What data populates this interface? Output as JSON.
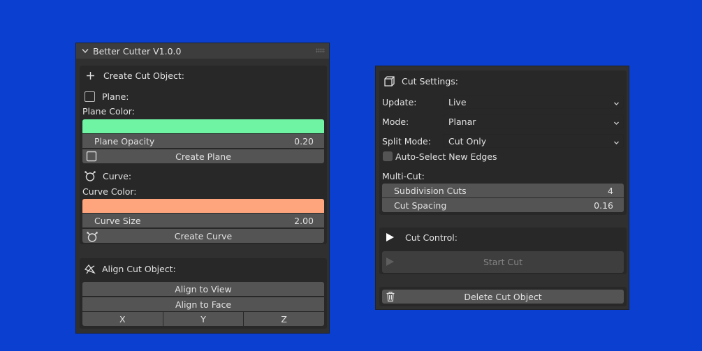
{
  "left_panel": {
    "title": "Better Cutter V1.0.0",
    "create_section": {
      "heading": "Create Cut Object:",
      "plane_label": "Plane:",
      "plane_color_label": "Plane Color:",
      "plane_color": "#6ff4a4",
      "plane_opacity_label": "Plane Opacity",
      "plane_opacity_value": "0.20",
      "create_plane_label": "Create Plane",
      "curve_label": "Curve:",
      "curve_color_label": "Curve Color:",
      "curve_color": "#ffa57d",
      "curve_size_label": "Curve Size",
      "curve_size_value": "2.00",
      "create_curve_label": "Create Curve"
    },
    "align_section": {
      "heading": "Align Cut Object:",
      "align_view_label": "Align to View",
      "align_face_label": "Align to Face",
      "axes": [
        "X",
        "Y",
        "Z"
      ]
    }
  },
  "right_panel": {
    "settings": {
      "heading": "Cut Settings:",
      "update_label": "Update:",
      "update_value": "Live",
      "mode_label": "Mode:",
      "mode_value": "Planar",
      "split_mode_label": "Split Mode:",
      "split_mode_value": "Cut Only",
      "auto_select_label": "Auto-Select New Edges",
      "multi_cut_label": "Multi-Cut:",
      "subdivision_label": "Subdivision Cuts",
      "subdivision_value": "4",
      "spacing_label": "Cut Spacing",
      "spacing_value": "0.16"
    },
    "control": {
      "heading": "Cut Control:",
      "start_label": "Start Cut"
    },
    "delete_label": "Delete Cut Object"
  },
  "colors": {
    "background": "#0a3fcf",
    "panel": "#303030",
    "field": "#545454"
  }
}
